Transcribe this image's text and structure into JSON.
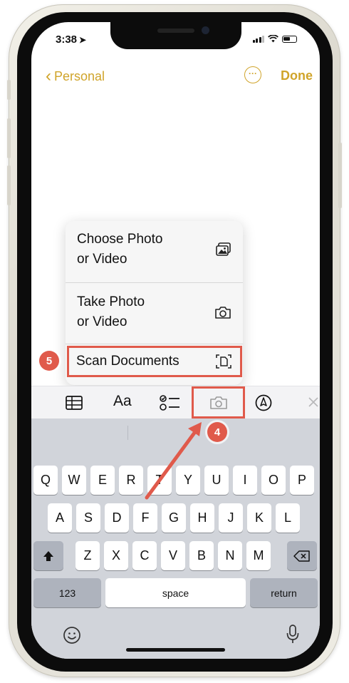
{
  "status": {
    "time": "3:38"
  },
  "nav": {
    "back_label": "Personal",
    "more_icon": "ellipsis-circle-icon",
    "done_label": "Done"
  },
  "menu": {
    "items": [
      {
        "line1": "Choose Photo",
        "line2": "or Video",
        "icon": "photo-library-icon"
      },
      {
        "line1": "Take Photo",
        "line2": "or Video",
        "icon": "camera-icon"
      }
    ],
    "scan": {
      "label": "Scan Documents",
      "icon": "document-scan-icon"
    }
  },
  "toolbar": {
    "table_icon": "table-icon",
    "format_label": "Aa",
    "checklist_icon": "checklist-icon",
    "camera_icon": "camera-icon",
    "markup_icon": "markup-pen-icon",
    "close_icon": "close-icon"
  },
  "annotations": {
    "step5": "5",
    "step4": "4",
    "highlight_color": "#e05a4b"
  },
  "keyboard": {
    "row1": [
      "Q",
      "W",
      "E",
      "R",
      "T",
      "Y",
      "U",
      "I",
      "O",
      "P"
    ],
    "row2": [
      "A",
      "S",
      "D",
      "F",
      "G",
      "H",
      "J",
      "K",
      "L"
    ],
    "row3": [
      "Z",
      "X",
      "C",
      "V",
      "B",
      "N",
      "M"
    ],
    "numbers_label": "123",
    "space_label": "space",
    "return_label": "return",
    "shift_icon": "shift-icon",
    "delete_icon": "delete-icon",
    "emoji_icon": "emoji-icon",
    "mic_icon": "microphone-icon"
  },
  "colors": {
    "accent": "#d0a42a",
    "keyboard_bg": "#d1d4da"
  }
}
